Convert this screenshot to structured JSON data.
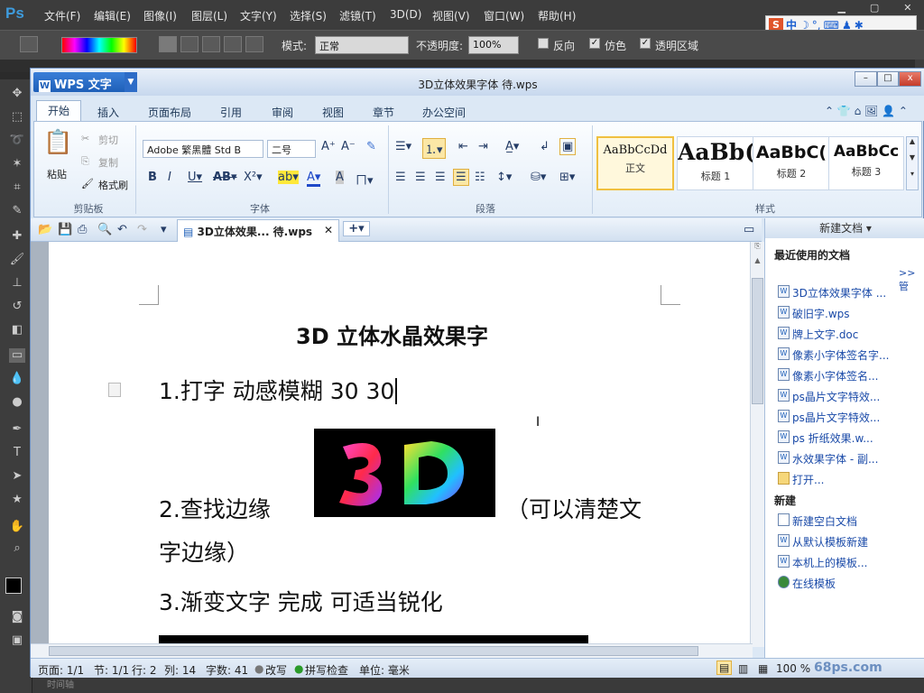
{
  "photoshop": {
    "logo": "Ps",
    "menu": [
      "文件(F)",
      "编辑(E)",
      "图像(I)",
      "图层(L)",
      "文字(Y)",
      "选择(S)",
      "滤镜(T)",
      "3D(D)",
      "视图(V)",
      "窗口(W)",
      "帮助(H)"
    ],
    "options": {
      "mode_label": "模式:",
      "mode_value": "正常",
      "opacity_label": "不透明度:",
      "opacity_value": "100%",
      "reverse_label": "反向",
      "dither_label": "仿色",
      "transparency_label": "透明区域"
    },
    "ime": {
      "logo": "S",
      "mode": "中"
    },
    "bottom_text": "时间轴"
  },
  "wps": {
    "app_label": "WPS 文字",
    "window_title": "3D立体效果字体  待.wps",
    "window_controls": {
      "min": "–",
      "max": "□",
      "close": "x"
    },
    "ribbon_tabs": [
      "开始",
      "插入",
      "页面布局",
      "引用",
      "审阅",
      "视图",
      "章节",
      "办公空间"
    ],
    "clipboard": {
      "paste": "粘贴",
      "cut": "剪切",
      "copy": "复制",
      "format_painter": "格式刷",
      "group": "剪贴板"
    },
    "font": {
      "family": "Adobe 繁黑體 Std B",
      "size": "二号",
      "group": "字体"
    },
    "paragraph": {
      "group": "段落"
    },
    "styles": {
      "group": "样式",
      "items": [
        {
          "preview": "AaBbCcDd",
          "name": "正文"
        },
        {
          "preview": "AaBb(",
          "name": "标题 1"
        },
        {
          "preview": "AaBbC(",
          "name": "标题 2"
        },
        {
          "preview": "AaBbCc",
          "name": "标题 3"
        }
      ]
    },
    "doc_tab": "3D立体效果... 待.wps",
    "document": {
      "heading": "3D 立体水晶效果字",
      "line1": "1.打字  动感模糊  30 30",
      "line2a": "2.查找边缘",
      "line2b": "（可以清楚文",
      "line2c": "字边缘）",
      "line3": "3.渐变文字  完成     可适当锐化"
    },
    "taskpane": {
      "header": "新建文档 ▾",
      "recent_title": "最近使用的文档",
      "more": ">> 管",
      "recent": [
        "3D立体效果字体 ...",
        "破旧字.wps",
        "牌上文字.doc",
        "像素小字体签名字...",
        "像素小字体签名...",
        "ps晶片文字特效...",
        "ps晶片文字特效...",
        "ps 折纸效果.w...",
        "水效果字体 - 副...",
        "打开..."
      ],
      "new_title": "新建",
      "new_items": [
        "新建空白文档",
        "从默认模板新建",
        "本机上的模板...",
        "在线模板"
      ]
    },
    "status": {
      "page": "页面: 1/1",
      "section": "节: 1/1",
      "row": "行: 2",
      "col": "列: 14",
      "words": "字数: 41",
      "overwrite": "改写",
      "spell": "拼写检查",
      "unit": "单位: 毫米",
      "zoom": "100 %"
    },
    "watermark": "68ps.com"
  }
}
